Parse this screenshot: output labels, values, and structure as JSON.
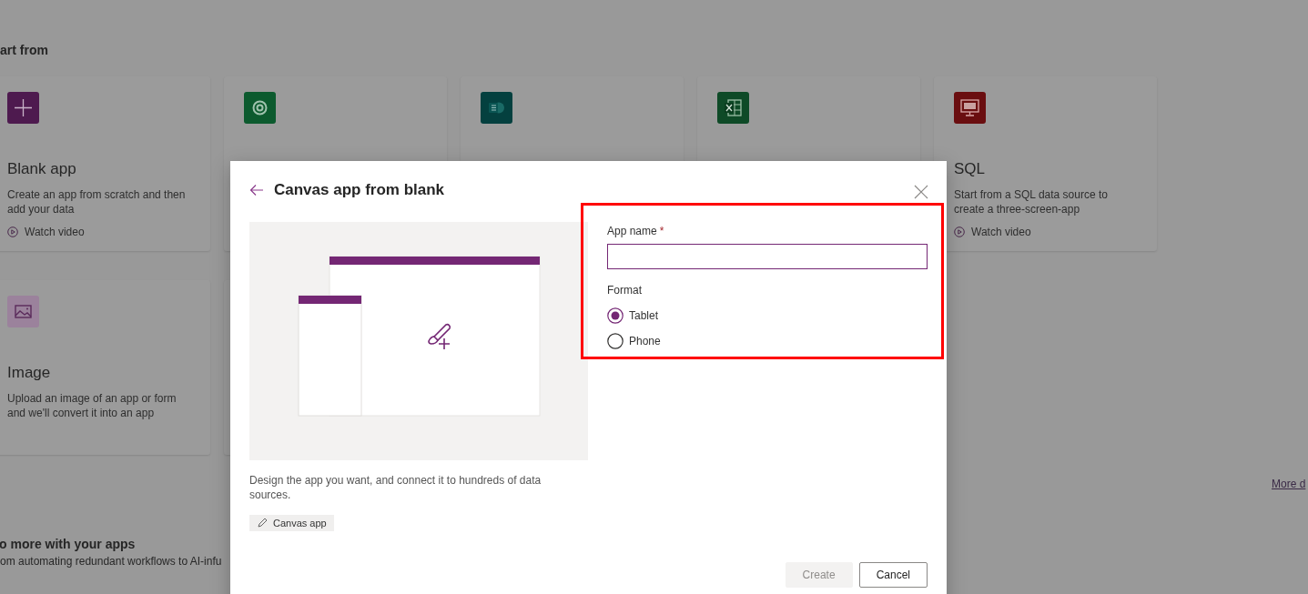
{
  "page": {
    "section_heading": "art from",
    "templates": [
      {
        "kind": "blank",
        "title": "Blank app",
        "description": "Create an app from scratch and then add your data",
        "link": "Watch video"
      },
      {
        "kind": "dataverse"
      },
      {
        "kind": "sharepoint"
      },
      {
        "kind": "excel"
      },
      {
        "kind": "sql",
        "title": "SQL",
        "description": "Start from a SQL data source to create a three-screen-app",
        "link": "Watch video"
      },
      {
        "kind": "image",
        "title": "Image",
        "description": "Upload an image of an app or form and we'll convert it into an app"
      },
      {
        "kind": "covered"
      }
    ],
    "more_link": "More d",
    "footer": {
      "heading": "o more with your apps",
      "text": "om automating redundant workflows to AI-infu"
    }
  },
  "dialog": {
    "title": "Canvas app from blank",
    "description": "Design the app you want, and connect it to hundreds of data sources.",
    "tag": "Canvas app",
    "form": {
      "label": "App name",
      "required_mark": "*",
      "focused": true,
      "format_label": "Format",
      "options": [
        {
          "label": "Tablet",
          "selected": true
        },
        {
          "label": "Phone",
          "selected": false
        }
      ]
    },
    "buttons": [
      {
        "label": "Create",
        "disabled": true
      },
      {
        "label": "Cancel",
        "disabled": false
      }
    ]
  }
}
